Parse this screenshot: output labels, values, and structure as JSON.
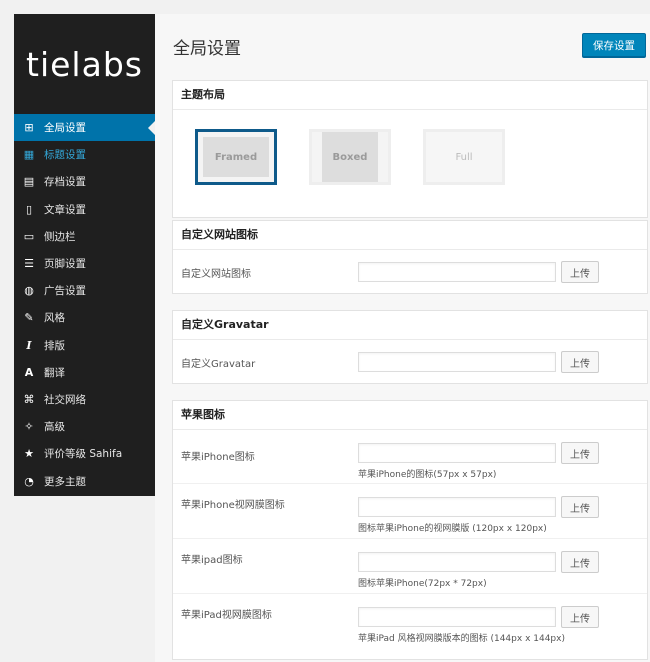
{
  "sidebar": {
    "logo": "tielabs",
    "items": [
      {
        "label": "全局设置",
        "icon": "home-icon",
        "glyph": "⊞"
      },
      {
        "label": "标题设置",
        "icon": "grid-icon",
        "glyph": "▦"
      },
      {
        "label": "存档设置",
        "icon": "archive-icon",
        "glyph": "▤"
      },
      {
        "label": "文章设置",
        "icon": "document-icon",
        "glyph": "▯"
      },
      {
        "label": "侧边栏",
        "icon": "sidebar-icon",
        "glyph": "▭"
      },
      {
        "label": "页脚设置",
        "icon": "footer-icon",
        "glyph": "☰"
      },
      {
        "label": "广告设置",
        "icon": "megaphone-icon",
        "glyph": "◍"
      },
      {
        "label": "风格",
        "icon": "brush-icon",
        "glyph": "✎"
      },
      {
        "label": "排版",
        "icon": "italic-icon",
        "glyph": "I"
      },
      {
        "label": "翻译",
        "icon": "translate-icon",
        "glyph": "A"
      },
      {
        "label": "社交网络",
        "icon": "network-icon",
        "glyph": "⌘"
      },
      {
        "label": "高级",
        "icon": "wrench-icon",
        "glyph": "✧"
      },
      {
        "label": "评价等级 Sahifa",
        "icon": "star-icon",
        "glyph": "★"
      },
      {
        "label": "更多主题",
        "icon": "clock-icon",
        "glyph": "◔"
      }
    ]
  },
  "header": {
    "title": "全局设置",
    "save_label": "保存设置"
  },
  "theme_layout": {
    "heading": "主题布局",
    "options": [
      "Framed",
      "Boxed",
      "Full"
    ]
  },
  "favicon": {
    "heading": "自定义网站图标",
    "label": "自定义网站图标",
    "upload": "上传"
  },
  "gravatar": {
    "heading": "自定义Gravatar",
    "label": "自定义Gravatar",
    "upload": "上传"
  },
  "apple": {
    "heading": "苹果图标",
    "rows": [
      {
        "label": "苹果iPhone图标",
        "hint": "苹果iPhone的图标(57px x 57px)",
        "upload": "上传"
      },
      {
        "label": "苹果iPhone视网膜图标",
        "hint": "图标苹果iPhone的视网膜版 (120px x 120px)",
        "upload": "上传"
      },
      {
        "label": "苹果ipad图标",
        "hint": "图标苹果iPhone(72px * 72px)",
        "upload": "上传"
      },
      {
        "label": "苹果iPad视网膜图标",
        "hint": "苹果iPad 风格视网膜版本的图标 (144px x 144px)",
        "upload": "上传"
      }
    ]
  },
  "colors": {
    "accent": "#0073aa",
    "sidebar_bg": "#1f1f1f",
    "selected_border": "#0e5a8a"
  }
}
